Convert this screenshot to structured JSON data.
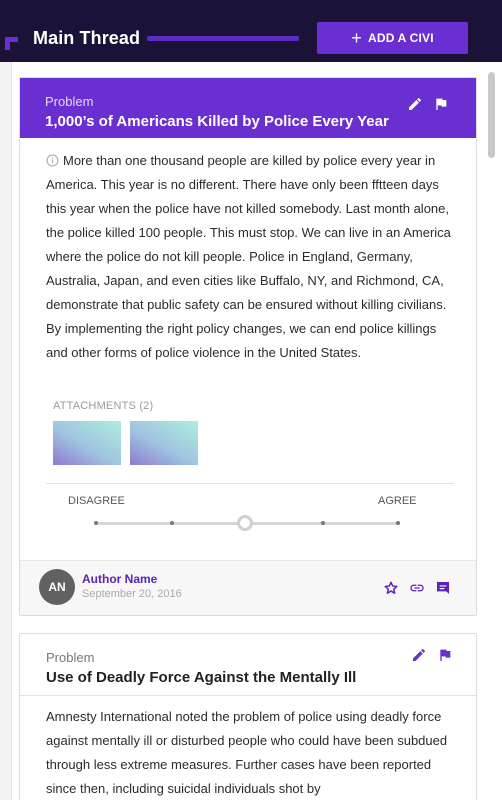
{
  "header": {
    "title": "Main Thread",
    "add_button_label": "ADD A CIVI"
  },
  "colors": {
    "header_bg": "#1a1237",
    "accent": "#6a2fd1",
    "author_link": "#5a22b8"
  },
  "civis": [
    {
      "type": "Problem",
      "title": "1,000’s of Americans Killed by Police Every Year",
      "body": "More than one thousand people are killed by police every year in America. This year is no different. There have only been fftteen days this year when the police have not killed somebody. Last month alone, the police killed 100 people. This must stop. We can live in an America where the police do not kill people. Police in England, Germany, Australia, Japan, and even cities like Buffalo, NY, and Richmond, CA, demonstrate that public safety can be ensured without killing civilians. By implementing the right policy changes, we can end police killings and other forms of police violence in the United States.",
      "attachments_label": "ATTACHMENTS (2)",
      "slider": {
        "left_label": "DISAGREE",
        "right_label": "AGREE",
        "value": 0.5
      },
      "author": {
        "initials": "AN",
        "name": "Author Name",
        "date": "September 20, 2016"
      },
      "icons": [
        "edit-icon",
        "flag-icon",
        "star-icon",
        "link-icon",
        "comment-icon"
      ]
    },
    {
      "type": "Problem",
      "title": "Use of Deadly Force Against the Mentally Ill",
      "body": "Amnesty International noted the problem of police using deadly force against mentally ill or disturbed people who could have been subdued through less extreme measures. Further cases have been reported since then, including suicidal individuals shot by",
      "icons": [
        "edit-icon",
        "flag-icon"
      ]
    }
  ]
}
